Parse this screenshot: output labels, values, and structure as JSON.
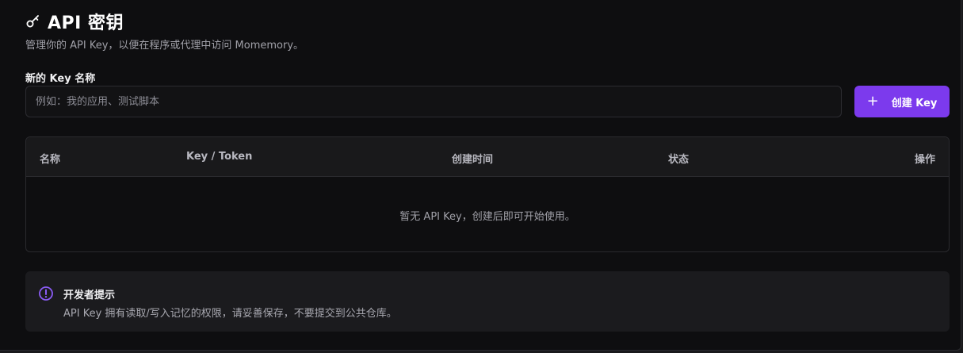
{
  "header": {
    "title": "API 密钥",
    "subtitle": "管理你的 API Key，以便在程序或代理中访问 Momemory。",
    "icon": "key-icon"
  },
  "form": {
    "label": "新的 Key 名称",
    "input_value": "",
    "input_placeholder": "例如：我的应用、测试脚本",
    "create_label": "创建 Key",
    "create_icon": "plus-icon"
  },
  "table": {
    "columns": [
      "名称",
      "Key / Token",
      "创建时间",
      "状态",
      "操作"
    ],
    "rows": [],
    "empty_text": "暂无 API Key，创建后即可开始使用。"
  },
  "tip": {
    "title": "开发者提示",
    "text": "API Key 拥有读取/写入记忆的权限，请妥善保存，不要提交到公共仓库。",
    "icon": "info-icon"
  },
  "colors": {
    "accent": "#7c3aed",
    "background": "#0e0e10",
    "panel": "#1b1b1e",
    "border": "#2a2a2e"
  }
}
